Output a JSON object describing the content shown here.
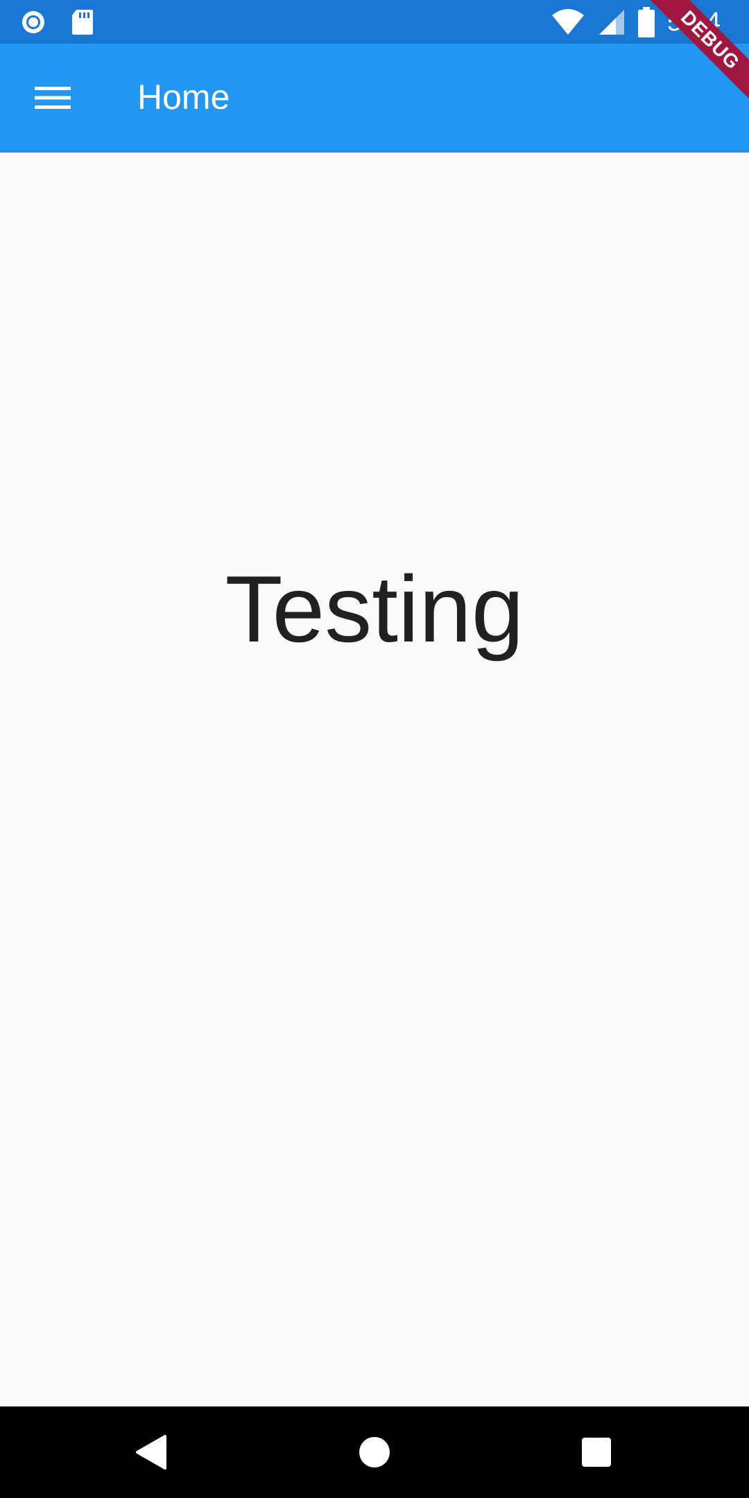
{
  "status_bar": {
    "time": "5:14",
    "icons": [
      "circle-notification-icon",
      "sd-card-icon",
      "wifi-icon",
      "signal-icon",
      "battery-icon"
    ]
  },
  "app_bar": {
    "title": "Home",
    "menu_icon": "hamburger-menu-icon"
  },
  "debug_banner": {
    "label": "DEBUG"
  },
  "body": {
    "text": "Testing"
  },
  "navigation_bar": {
    "buttons": [
      "back-icon",
      "home-icon",
      "recents-icon"
    ]
  },
  "colors": {
    "status_bar": "#1976d2",
    "app_bar": "#2196f3",
    "background": "#fafafa",
    "text": "#212121",
    "debug_banner": "#a01840",
    "nav_bar": "#000000"
  }
}
